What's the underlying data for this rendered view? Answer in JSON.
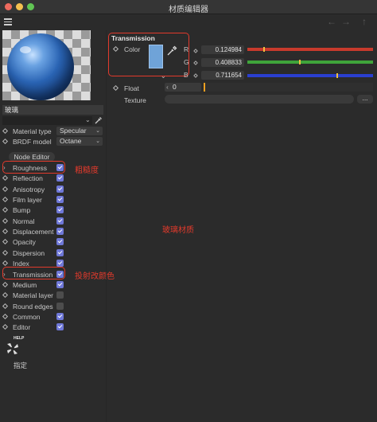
{
  "window": {
    "title": "材质编辑器"
  },
  "toolbar": {
    "back": "←",
    "forward": "→",
    "up": "↑"
  },
  "material": {
    "name": "玻璃"
  },
  "properties": {
    "material_type": {
      "label": "Material type",
      "value": "Specular"
    },
    "brdf_model": {
      "label": "BRDF model",
      "value": "Octane"
    }
  },
  "node_editor": "Node Editor",
  "channels": [
    {
      "label": "Roughness",
      "checked": true
    },
    {
      "label": "Reflection",
      "checked": true
    },
    {
      "label": "Anisotropy",
      "checked": true
    },
    {
      "label": "Film layer",
      "checked": true
    },
    {
      "label": "Bump",
      "checked": true
    },
    {
      "label": "Normal",
      "checked": true
    },
    {
      "label": "Displacement",
      "checked": true
    },
    {
      "label": "Opacity",
      "checked": true
    },
    {
      "label": "Dispersion",
      "checked": true
    },
    {
      "label": "Index",
      "checked": true
    },
    {
      "label": "Transmission",
      "checked": true
    },
    {
      "label": "Medium",
      "checked": true
    },
    {
      "label": "Material layer",
      "checked": false
    },
    {
      "label": "Round edges",
      "checked": false
    },
    {
      "label": "Common",
      "checked": true
    },
    {
      "label": "Editor",
      "checked": true
    }
  ],
  "annotations": {
    "roughness": "粗糙度",
    "transmission": "投射改颜色",
    "center": "玻璃材质"
  },
  "help": {
    "badge": "HELP",
    "label": "指定"
  },
  "transmission_panel": {
    "title": "Transmission",
    "color_label": "Color",
    "color_hex": "#6fa3d8",
    "r": {
      "label": "R",
      "value": "0.124984"
    },
    "g": {
      "label": "G",
      "value": "0.408833"
    },
    "b": {
      "label": "B",
      "value": "0.711654"
    },
    "float_label": "Float",
    "float_value": "0",
    "texture_label": "Texture",
    "texture_button": "..."
  },
  "colors": {
    "accent": "#6f78d8",
    "annotation": "#e23a2c",
    "slider_r": "#c83a2c",
    "slider_g": "#3fa43a",
    "slider_b": "#2a3fd0"
  }
}
